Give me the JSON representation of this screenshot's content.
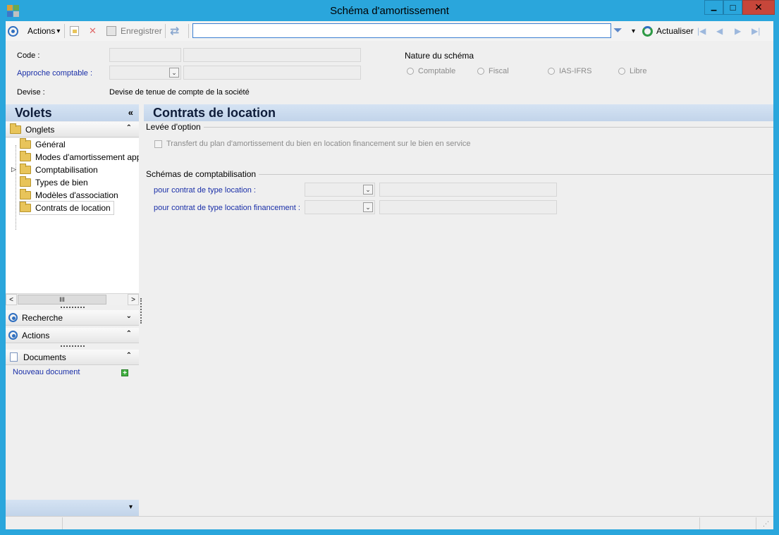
{
  "window": {
    "title": "Schéma d'amortissement",
    "close_glyph": "✕",
    "min_glyph": "▁",
    "max_glyph": "□"
  },
  "toolbar": {
    "actions_label": "Actions",
    "save_label": "Enregistrer",
    "search_value": "",
    "refresh_label": "Actualiser",
    "dropdown_glyph": "▾",
    "nav_first": "|◀",
    "nav_prev": "◀",
    "nav_next": "▶",
    "nav_last": "▶|"
  },
  "header": {
    "code_label": "Code :",
    "approche_label": "Approche comptable :",
    "devise_label": "Devise :",
    "devise_value": "Devise de tenue de compte de la société",
    "nature_label": "Nature du schéma",
    "nature_options": [
      "Comptable",
      "Fiscal",
      "IAS-IFRS",
      "Libre"
    ],
    "code_value": "",
    "code_desc": "",
    "approche_value": "",
    "approche_desc": ""
  },
  "left_panel": {
    "title": "Volets",
    "collapse_glyph": "«",
    "onglets_label": "Onglets",
    "tree_items": [
      "Général",
      "Modes d'amortissement app",
      "Comptabilisation",
      "Types de bien",
      "Modèles d'association",
      "Contrats de location"
    ],
    "recherche_label": "Recherche",
    "actions_label": "Actions",
    "documents_label": "Documents",
    "new_document_label": "Nouveau document",
    "scroll_thumb_glyph": "III",
    "scroll_left": "<",
    "scroll_right": ">",
    "chev_up": "⌃",
    "chev_down": "⌄",
    "bottom_glyph": "▾"
  },
  "main": {
    "title": "Contrats de location",
    "option_group_title": "Levée d'option",
    "option_checkbox_label": "Transfert du plan d'amortissement du bien en location financement sur le bien en service",
    "option_checked": false,
    "schemes_group_title": "Schémas de comptabilisation",
    "location_label": "pour contrat de type location :",
    "location_fin_label": "pour contrat de type location financement :",
    "location_value": "",
    "location_desc": "",
    "location_fin_value": "",
    "location_fin_desc": ""
  },
  "colors": {
    "window_frame": "#2aa6dc",
    "panel_header": "#c9d9ee",
    "link_blue": "#1a2fa8",
    "close_red": "#c7463a"
  }
}
